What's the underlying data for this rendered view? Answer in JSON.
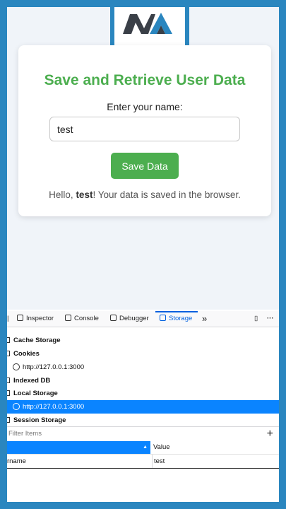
{
  "app": {
    "title": "Save and Retrieve User Data",
    "input_label": "Enter your name:",
    "input_value": "test",
    "save_label": "Save Data",
    "greeting_prefix": "Hello,",
    "greeting_name": "test",
    "greeting_suffix": "! Your data is saved in the browser."
  },
  "devtools": {
    "tabs": [
      "Inspector",
      "Console",
      "Debugger",
      "Storage"
    ],
    "active_tab": "Storage",
    "tree": {
      "cache_storage": "Cache Storage",
      "cookies": "Cookies",
      "cookies_origin": "http://127.0.0.1:3000",
      "indexed_db": "Indexed DB",
      "local_storage": "Local Storage",
      "local_storage_origin": "http://127.0.0.1:3000",
      "session_storage": "Session Storage"
    },
    "filter_placeholder": "Filter Items",
    "table": {
      "columns": [
        "",
        "Value"
      ],
      "rows": [
        {
          "key": "rname",
          "value": "test"
        }
      ]
    }
  },
  "colors": {
    "accent_green": "#4cae4f",
    "frame_blue": "#2a86bf",
    "selection_blue": "#0a84ff"
  }
}
